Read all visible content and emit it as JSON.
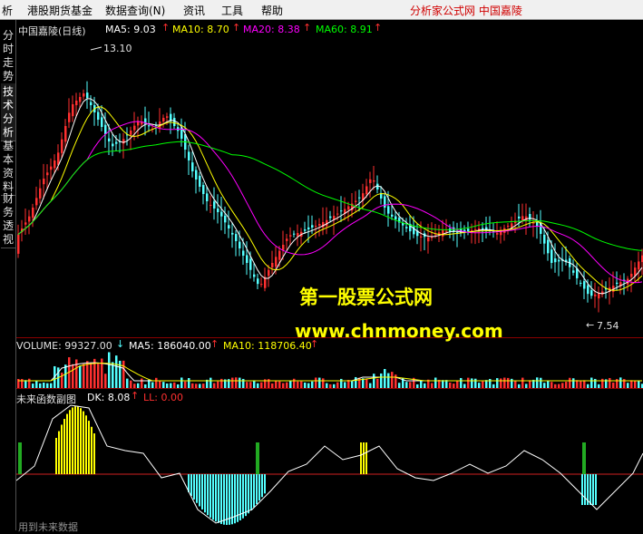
{
  "menu": {
    "items": [
      "析",
      "港股期货基金",
      "数据查询(N)",
      "资讯",
      "工具",
      "帮助"
    ],
    "brand": "分析家公式网  中国嘉陵"
  },
  "side_tabs": [
    {
      "label": "分时走势"
    },
    {
      "label": "技术分析"
    },
    {
      "label": "基本资料"
    },
    {
      "label": "财务透视"
    }
  ],
  "main_panel": {
    "title": "中国嘉陵(日线)",
    "ma5": "MA5: 9.03",
    "ma10": "MA10: 8.70",
    "ma20": "MA20: 8.38",
    "ma60": "MA60: 8.91",
    "high_label": "13.10",
    "low_label": "7.54"
  },
  "volume_panel": {
    "volume": "VOLUME: 99327.00",
    "ma5": "MA5: 186040.00",
    "ma10": "MA10: 118706.40"
  },
  "indicator_panel": {
    "name": "未来函数副图",
    "dk": "DK: 8.08",
    "ll": "LL: 0.00"
  },
  "watermark": {
    "line1": "第一股票公式网",
    "line2": "www.chnmoney.com"
  },
  "bottom_text": "用到未来数据",
  "colors": {
    "up_candle": "#ff3030",
    "down_candle": "#54ffff",
    "ma5": "#ffffff",
    "ma10": "#ffff00",
    "ma20": "#ff00ff",
    "ma60": "#00ff00",
    "watermark": "#ffff00",
    "border": "#8b0000"
  }
}
